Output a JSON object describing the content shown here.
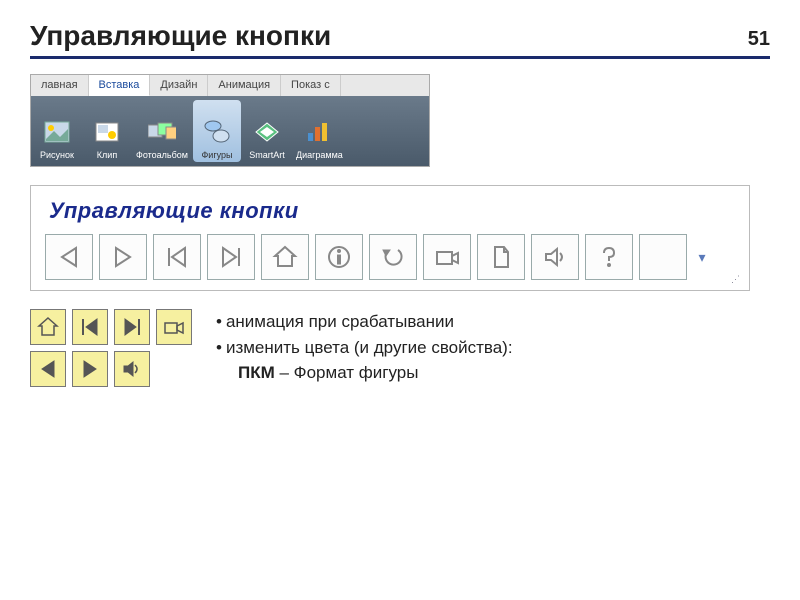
{
  "page_number": "51",
  "title": "Управляющие кнопки",
  "ribbon": {
    "tabs": [
      "лавная",
      "Вставка",
      "Дизайн",
      "Анимация",
      "Показ с"
    ],
    "active_tab_index": 1,
    "buttons": [
      {
        "label": "Рисунок",
        "icon": "picture"
      },
      {
        "label": "Клип",
        "icon": "clip"
      },
      {
        "label": "Фотоальбом",
        "icon": "photoalbum"
      },
      {
        "label": "Фигуры",
        "icon": "shapes",
        "highlight": true
      },
      {
        "label": "SmartArt",
        "icon": "smartart"
      },
      {
        "label": "Диаграмма",
        "icon": "chart"
      }
    ]
  },
  "panel": {
    "title": "Управляющие кнопки",
    "buttons": [
      "back",
      "forward",
      "begin",
      "end",
      "home",
      "info",
      "return",
      "movie",
      "document",
      "sound",
      "help",
      "blank"
    ]
  },
  "yellow_buttons": {
    "row1": [
      "home",
      "first",
      "next-pause",
      "movie"
    ],
    "row2": [
      "prev",
      "next",
      "sound"
    ]
  },
  "bullets": {
    "item1": "анимация при срабатывании",
    "item2": "изменить цвета (и другие свойства):",
    "sub_bold": "ПКМ",
    "sub_rest": " – Формат фигуры"
  }
}
